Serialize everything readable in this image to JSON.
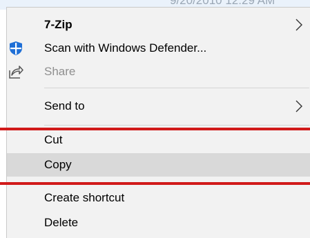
{
  "background": {
    "timestamp": "9/20/2010 12:29 AM"
  },
  "context_menu": {
    "items": [
      {
        "label": "7-Zip",
        "has_submenu": true,
        "bold": true
      },
      {
        "label": "Scan with Windows Defender...",
        "icon": "windows-defender-shield-icon"
      },
      {
        "label": "Share",
        "icon": "share-icon",
        "disabled": true
      },
      {
        "label": "Send to",
        "has_submenu": true
      },
      {
        "label": "Cut"
      },
      {
        "label": "Copy",
        "highlighted": true
      },
      {
        "label": "Create shortcut"
      },
      {
        "label": "Delete"
      }
    ]
  },
  "colors": {
    "menu_background": "#f2f2f2",
    "hover": "#d9d9d9",
    "annotation_red": "#d11a1a",
    "defender_blue": "#1f6fd6"
  }
}
